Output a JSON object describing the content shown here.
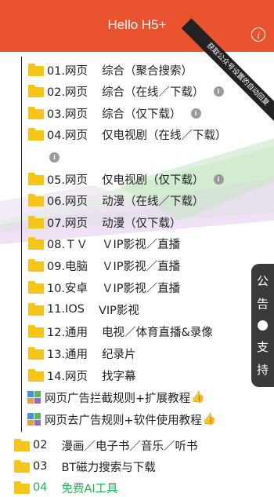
{
  "header": {
    "title": "Hello H5+",
    "info_glyph": "i"
  },
  "ribbon": {
    "text": "获取公众号设置的自动回复"
  },
  "items": [
    {
      "prefix": "01.网页",
      "desc": "综合（聚合搜索）",
      "note": false
    },
    {
      "prefix": "02.网页",
      "desc": "综合（在线／下载）",
      "note": true
    },
    {
      "prefix": "03.网页",
      "desc": "综合（仅下载）",
      "note": true
    },
    {
      "prefix": "04.网页",
      "desc": "仅电视剧（在线／下载）",
      "note": true
    },
    {
      "prefix": "05.网页",
      "desc": "仅电视剧（仅下载）",
      "note": true
    },
    {
      "prefix": "06.网页",
      "desc": "动漫（在线／下载）",
      "note": false
    },
    {
      "prefix": "07.网页",
      "desc": "动漫（仅下载）",
      "note": false
    },
    {
      "prefix": "08.ＴＶ",
      "desc": "ＶIP影视／直播",
      "note": false
    },
    {
      "prefix": "09.电脑",
      "desc": "ＶIP影视／直播",
      "note": false
    },
    {
      "prefix": "10.安卓",
      "desc": "ＶIP影视／直播",
      "note": false
    },
    {
      "prefix": "11.IOS",
      "desc": "VIP影视",
      "note": false
    },
    {
      "prefix": "12.通用",
      "desc": "电视／体育直播&录像",
      "note": false
    },
    {
      "prefix": "13.通用",
      "desc": "纪录片",
      "note": false
    },
    {
      "prefix": "14.网页",
      "desc": "找字幕",
      "note": false
    }
  ],
  "app_links": [
    {
      "label": "网页广告拦截规则+扩展教程",
      "emoji": "👍"
    },
    {
      "label": "网页去广告规则+软件使用教程",
      "emoji": "👍"
    }
  ],
  "sections": [
    {
      "num": "02",
      "label": "漫画／电子书／音乐／听书"
    },
    {
      "num": "03",
      "label": "BT磁力搜索与下载"
    },
    {
      "num": "04",
      "label": "免费AI工具"
    }
  ],
  "side_tab": {
    "top": "公",
    "top2": "告",
    "bottom": "支",
    "bottom2": "持"
  },
  "colors": {
    "header": "#e9522f",
    "folder": "#f5c518",
    "side_tab": "#3a3a3a",
    "green_text": "#1db954"
  }
}
